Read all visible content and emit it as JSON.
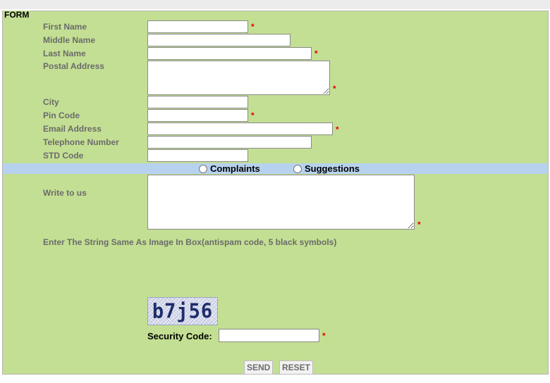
{
  "form": {
    "legend": "FORM",
    "fields": {
      "first_name": {
        "label": "First Name",
        "value": ""
      },
      "middle_name": {
        "label": "Middle Name",
        "value": ""
      },
      "last_name": {
        "label": "Last Name",
        "value": ""
      },
      "postal_address": {
        "label": "Postal Address",
        "value": ""
      },
      "city": {
        "label": "City",
        "value": ""
      },
      "pin_code": {
        "label": "Pin Code",
        "value": ""
      },
      "email": {
        "label": "Email Address",
        "value": ""
      },
      "telephone": {
        "label": "Telephone Number",
        "value": ""
      },
      "std_code": {
        "label": "STD Code",
        "value": ""
      }
    },
    "required_marker": "*",
    "category": {
      "options": [
        {
          "label": "Complaints",
          "checked": false
        },
        {
          "label": "Suggestions",
          "checked": false
        }
      ]
    },
    "write_to_us": {
      "label": "Write to us",
      "value": ""
    },
    "antispam_instruction": "Enter The String Same As Image In Box(antispam code, 5 black symbols)",
    "captcha_text": "b7j56",
    "security_code": {
      "label": "Security Code:",
      "value": ""
    },
    "buttons": {
      "send": "SEND",
      "reset": "RESET"
    }
  },
  "colors": {
    "form_background": "#c3df93",
    "category_bar": "#b7d2ef",
    "required_marker": "#e60000",
    "label_text": "#6b6b6b"
  }
}
